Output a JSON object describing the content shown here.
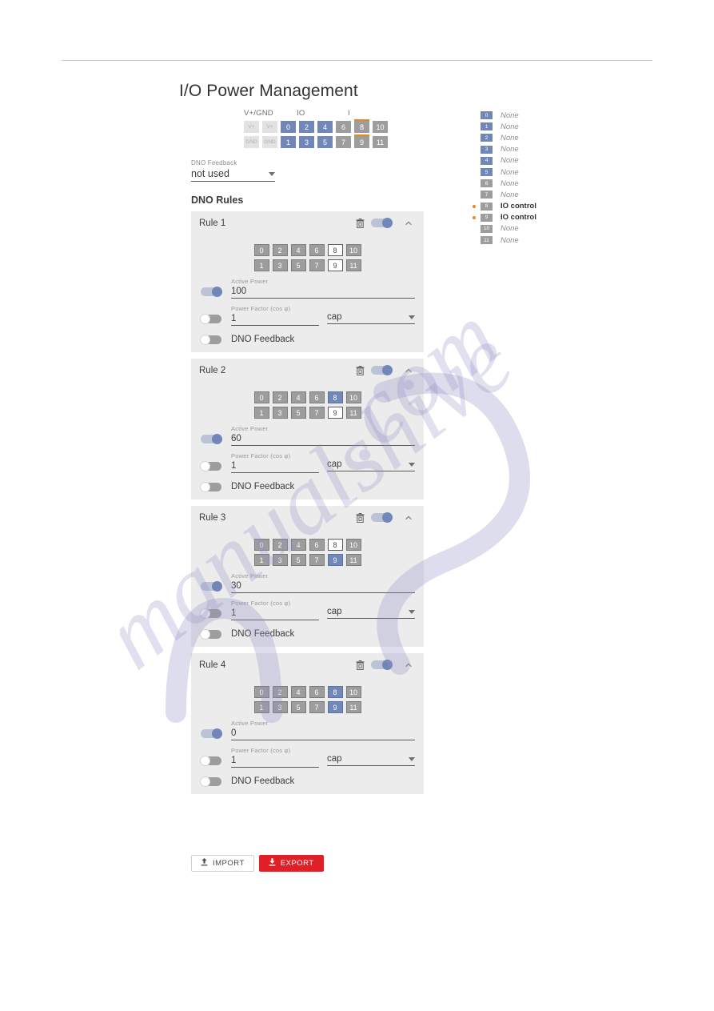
{
  "page": {
    "title": "I/O Power Management"
  },
  "pinmap": {
    "labels": {
      "vgnd": "V+/GND",
      "io": "IO",
      "i": "I"
    },
    "power_cells": [
      {
        "label": "V+",
        "state": "vg"
      },
      {
        "label": "V+",
        "state": "vg"
      },
      {
        "label": "GND",
        "state": "vg"
      },
      {
        "label": "GND",
        "state": "vg"
      }
    ],
    "top_row": [
      {
        "label": "0",
        "state": "blue",
        "tick": false
      },
      {
        "label": "2",
        "state": "blue",
        "tick": false
      },
      {
        "label": "4",
        "state": "blue",
        "tick": false
      },
      {
        "label": "6",
        "state": "gray",
        "tick": false
      },
      {
        "label": "8",
        "state": "gray",
        "tick": true
      },
      {
        "label": "10",
        "state": "gray",
        "tick": false
      }
    ],
    "bottom_row": [
      {
        "label": "1",
        "state": "blue",
        "tick": false
      },
      {
        "label": "3",
        "state": "blue",
        "tick": false
      },
      {
        "label": "5",
        "state": "blue",
        "tick": false
      },
      {
        "label": "7",
        "state": "gray",
        "tick": false
      },
      {
        "label": "9",
        "state": "gray",
        "tick": true
      },
      {
        "label": "11",
        "state": "gray",
        "tick": false
      }
    ]
  },
  "dno_feedback_select": {
    "label": "DNO Feedback",
    "value": "not used"
  },
  "rules_section": {
    "heading": "DNO Rules"
  },
  "rules": [
    {
      "name": "Rule 1",
      "enabled": true,
      "expanded": true,
      "grid_top": [
        {
          "label": "0",
          "state": "sel-gray"
        },
        {
          "label": "2",
          "state": "sel-gray"
        },
        {
          "label": "4",
          "state": "sel-gray"
        },
        {
          "label": "6",
          "state": "sel-gray"
        },
        {
          "label": "8",
          "state": "sel-white"
        },
        {
          "label": "10",
          "state": "sel-gray"
        }
      ],
      "grid_bottom": [
        {
          "label": "1",
          "state": "sel-gray"
        },
        {
          "label": "3",
          "state": "sel-gray"
        },
        {
          "label": "5",
          "state": "sel-gray"
        },
        {
          "label": "7",
          "state": "sel-gray"
        },
        {
          "label": "9",
          "state": "sel-white"
        },
        {
          "label": "11",
          "state": "sel-gray"
        }
      ],
      "active_power": {
        "label": "Active Power",
        "value": "100",
        "toggle": true
      },
      "power_factor": {
        "label": "Power Factor (cos φ)",
        "value": "1",
        "toggle": false
      },
      "cap_select": {
        "value": "cap"
      },
      "dno_feedback": {
        "label": "DNO Feedback",
        "toggle": false
      }
    },
    {
      "name": "Rule 2",
      "enabled": true,
      "expanded": true,
      "grid_top": [
        {
          "label": "0",
          "state": "sel-gray"
        },
        {
          "label": "2",
          "state": "sel-gray"
        },
        {
          "label": "4",
          "state": "sel-gray"
        },
        {
          "label": "6",
          "state": "sel-gray"
        },
        {
          "label": "8",
          "state": "sel-blue"
        },
        {
          "label": "10",
          "state": "sel-gray"
        }
      ],
      "grid_bottom": [
        {
          "label": "1",
          "state": "sel-gray"
        },
        {
          "label": "3",
          "state": "sel-gray"
        },
        {
          "label": "5",
          "state": "sel-gray"
        },
        {
          "label": "7",
          "state": "sel-gray"
        },
        {
          "label": "9",
          "state": "sel-white"
        },
        {
          "label": "11",
          "state": "sel-gray"
        }
      ],
      "active_power": {
        "label": "Active Power",
        "value": "60",
        "toggle": true
      },
      "power_factor": {
        "label": "Power Factor (cos φ)",
        "value": "1",
        "toggle": false
      },
      "cap_select": {
        "value": "cap"
      },
      "dno_feedback": {
        "label": "DNO Feedback",
        "toggle": false
      }
    },
    {
      "name": "Rule 3",
      "enabled": true,
      "expanded": true,
      "grid_top": [
        {
          "label": "0",
          "state": "sel-gray"
        },
        {
          "label": "2",
          "state": "sel-gray"
        },
        {
          "label": "4",
          "state": "sel-gray"
        },
        {
          "label": "6",
          "state": "sel-gray"
        },
        {
          "label": "8",
          "state": "sel-white"
        },
        {
          "label": "10",
          "state": "sel-gray"
        }
      ],
      "grid_bottom": [
        {
          "label": "1",
          "state": "sel-gray"
        },
        {
          "label": "3",
          "state": "sel-gray"
        },
        {
          "label": "5",
          "state": "sel-gray"
        },
        {
          "label": "7",
          "state": "sel-gray"
        },
        {
          "label": "9",
          "state": "sel-blue"
        },
        {
          "label": "11",
          "state": "sel-gray"
        }
      ],
      "active_power": {
        "label": "Active Power",
        "value": "30",
        "toggle": true
      },
      "power_factor": {
        "label": "Power Factor (cos φ)",
        "value": "1",
        "toggle": false
      },
      "cap_select": {
        "value": "cap"
      },
      "dno_feedback": {
        "label": "DNO Feedback",
        "toggle": false
      }
    },
    {
      "name": "Rule 4",
      "enabled": true,
      "expanded": true,
      "grid_top": [
        {
          "label": "0",
          "state": "sel-gray"
        },
        {
          "label": "2",
          "state": "sel-gray"
        },
        {
          "label": "4",
          "state": "sel-gray"
        },
        {
          "label": "6",
          "state": "sel-gray"
        },
        {
          "label": "8",
          "state": "sel-blue"
        },
        {
          "label": "10",
          "state": "sel-gray"
        }
      ],
      "grid_bottom": [
        {
          "label": "1",
          "state": "sel-gray"
        },
        {
          "label": "3",
          "state": "sel-gray"
        },
        {
          "label": "5",
          "state": "sel-gray"
        },
        {
          "label": "7",
          "state": "sel-gray"
        },
        {
          "label": "9",
          "state": "sel-blue"
        },
        {
          "label": "11",
          "state": "sel-gray"
        }
      ],
      "active_power": {
        "label": "Active Power",
        "value": "0",
        "toggle": true
      },
      "power_factor": {
        "label": "Power Factor (cos φ)",
        "value": "1",
        "toggle": false
      },
      "cap_select": {
        "value": "cap"
      },
      "dno_feedback": {
        "label": "DNO Feedback",
        "toggle": false
      }
    }
  ],
  "legend": [
    {
      "index": "0",
      "badge": "blue",
      "text": "None",
      "style": "none",
      "dot": false
    },
    {
      "index": "1",
      "badge": "blue",
      "text": "None",
      "style": "none",
      "dot": false
    },
    {
      "index": "2",
      "badge": "blue",
      "text": "None",
      "style": "none",
      "dot": false
    },
    {
      "index": "3",
      "badge": "blue",
      "text": "None",
      "style": "none",
      "dot": false
    },
    {
      "index": "4",
      "badge": "blue",
      "text": "None",
      "style": "none",
      "dot": false
    },
    {
      "index": "5",
      "badge": "blue",
      "text": "None",
      "style": "none",
      "dot": false
    },
    {
      "index": "6",
      "badge": "gray",
      "text": "None",
      "style": "none",
      "dot": false
    },
    {
      "index": "7",
      "badge": "gray",
      "text": "None",
      "style": "none",
      "dot": false
    },
    {
      "index": "8",
      "badge": "gray",
      "text": "IO control",
      "style": "ctrl",
      "dot": true
    },
    {
      "index": "9",
      "badge": "gray",
      "text": "IO control",
      "style": "ctrl",
      "dot": true
    },
    {
      "index": "10",
      "badge": "gray",
      "text": "None",
      "style": "none",
      "dot": false
    },
    {
      "index": "11",
      "badge": "gray",
      "text": "None",
      "style": "none",
      "dot": false
    }
  ],
  "footer": {
    "import_label": "IMPORT",
    "export_label": "EXPORT"
  },
  "colors": {
    "accent_blue": "#7187b8",
    "accent_gray": "#9d9d9d",
    "accent_orange": "#e98a15",
    "export_red": "#e01f26",
    "card_bg": "#ececec"
  },
  "watermark": {
    "text": "manualshive.com"
  }
}
